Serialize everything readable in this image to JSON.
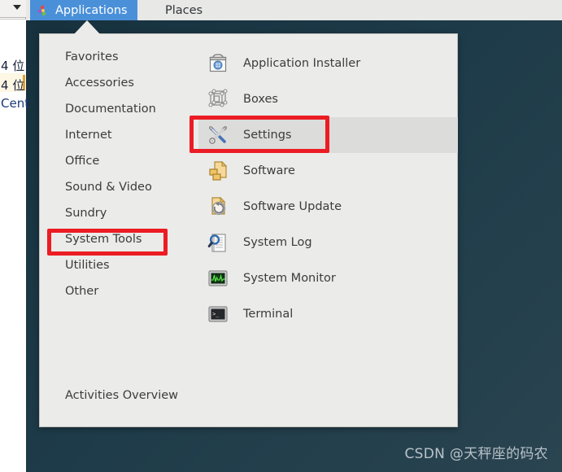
{
  "desktop": {
    "background_color": "#1e3b49",
    "watermark": "CSDN @天秤座的码农"
  },
  "background_window": {
    "caret_icon": "caret-down-icon",
    "lines": [
      "4 位",
      "4 位",
      "Cent"
    ]
  },
  "top_panel": {
    "background_color": "#e8e8e7",
    "tabs": [
      {
        "id": "applications",
        "label": "Applications",
        "icon": "gnome-applications-icon",
        "active": true,
        "accent_color": "#4a90d9"
      },
      {
        "id": "places",
        "label": "Places",
        "active": false
      }
    ]
  },
  "app_menu": {
    "categories": [
      {
        "label": "Favorites",
        "highlighted": false
      },
      {
        "label": "Accessories",
        "highlighted": false
      },
      {
        "label": "Documentation",
        "highlighted": false
      },
      {
        "label": "Internet",
        "highlighted": false
      },
      {
        "label": "Office",
        "highlighted": false
      },
      {
        "label": "Sound & Video",
        "highlighted": false
      },
      {
        "label": "Sundry",
        "highlighted": false
      },
      {
        "label": "System Tools",
        "highlighted": true
      },
      {
        "label": "Utilities",
        "highlighted": false
      },
      {
        "label": "Other",
        "highlighted": false
      }
    ],
    "activities_label": "Activities Overview",
    "applications": [
      {
        "label": "Application Installer",
        "icon": "shopping-bag-icon",
        "selected": false
      },
      {
        "label": "Boxes",
        "icon": "wireframe-box-icon",
        "selected": false
      },
      {
        "label": "Settings",
        "icon": "wrench-screwdriver-icon",
        "selected": true
      },
      {
        "label": "Software",
        "icon": "software-package-icon",
        "selected": false
      },
      {
        "label": "Software Update",
        "icon": "software-update-icon",
        "selected": false
      },
      {
        "label": "System Log",
        "icon": "magnifier-document-icon",
        "selected": false
      },
      {
        "label": "System Monitor",
        "icon": "monitor-graph-icon",
        "selected": false
      },
      {
        "label": "Terminal",
        "icon": "terminal-icon",
        "selected": false
      }
    ]
  },
  "annotations": {
    "highlight_color": "#ec1c24",
    "boxes": [
      {
        "target": "System Tools"
      },
      {
        "target": "Settings"
      }
    ]
  }
}
